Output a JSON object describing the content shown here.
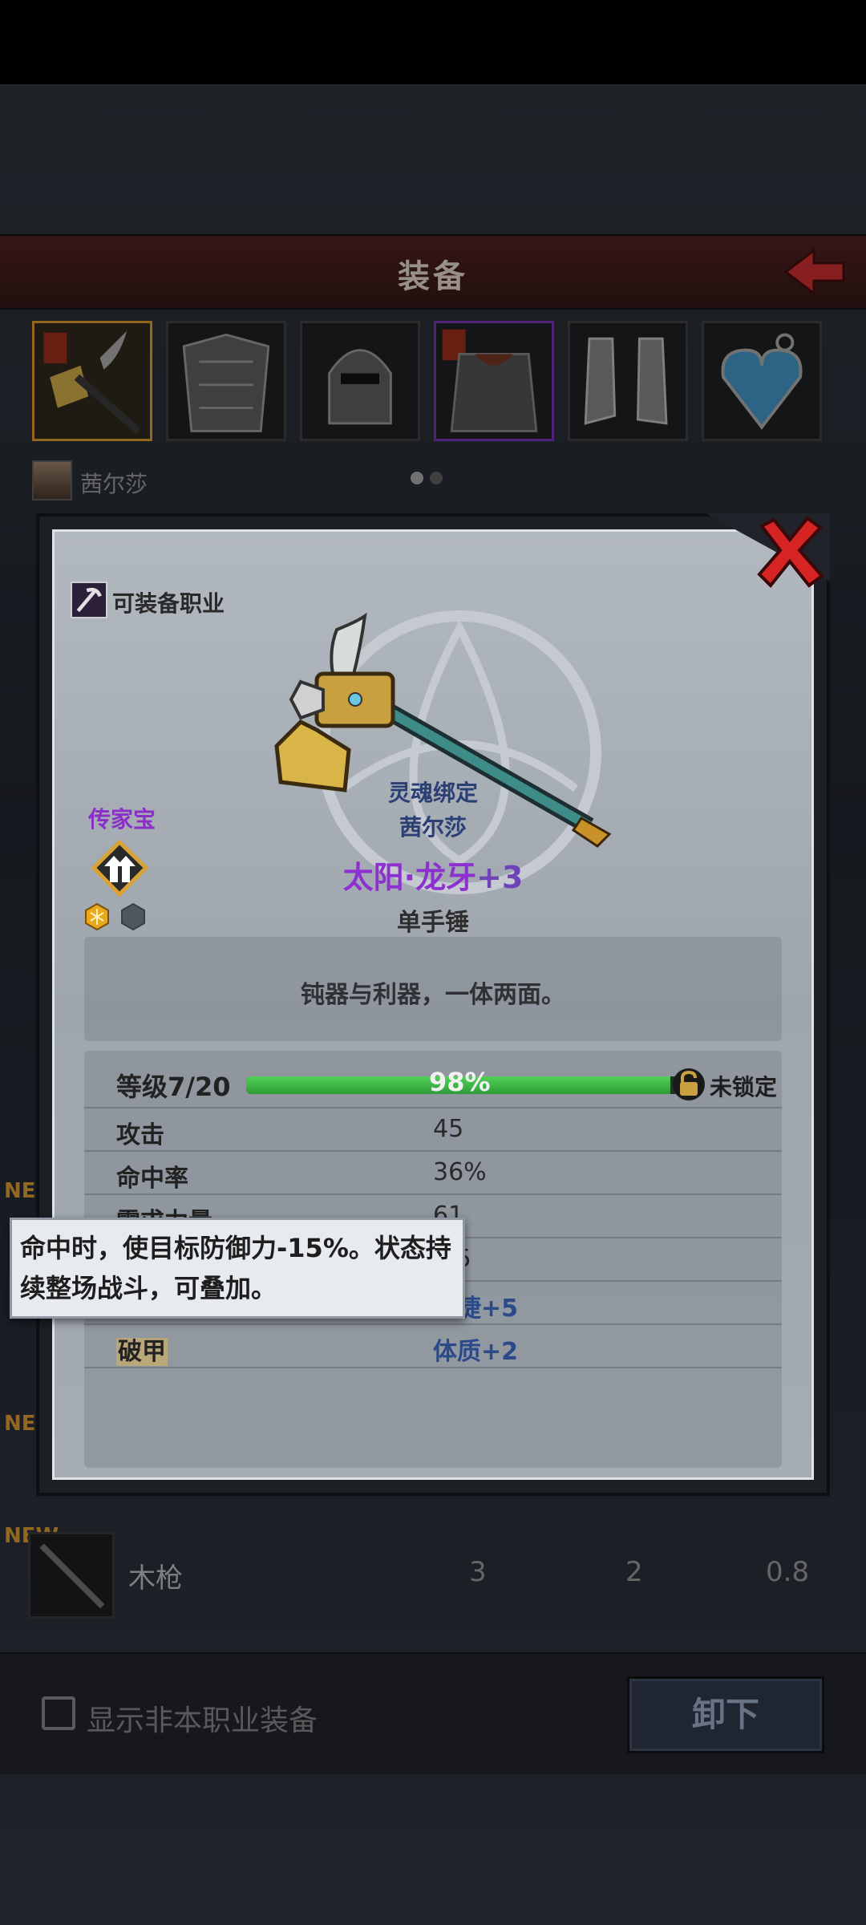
{
  "header": {
    "title": "装备"
  },
  "character": {
    "name": "茜尔莎"
  },
  "list": {
    "new_label": "NEW",
    "row": {
      "name": "木枪",
      "v1": "3",
      "v2": "2",
      "v3": "0.8"
    }
  },
  "bottom": {
    "show_non_class_label": "显示非本职业装备",
    "unequip_label": "卸下"
  },
  "modal": {
    "class_label": "可装备职业",
    "heirloom_label": "传家宝",
    "soulbind_line1": "灵魂绑定",
    "soulbind_line2": "茜尔莎",
    "item_name": "太阳·龙牙",
    "item_plus": "+3",
    "item_type": "单手锤",
    "description": "钝器与利器，一体两面。",
    "level": {
      "label": "等级7/20",
      "progress_text": "98%",
      "progress": 0.98,
      "lock_text": "未锁定"
    },
    "stats": [
      {
        "label": "攻击",
        "value": "45"
      },
      {
        "label": "命中率",
        "value": "36%"
      },
      {
        "label": "需求力量",
        "value": "61"
      },
      {
        "label": "",
        "value": "1.5"
      },
      {
        "label": "",
        "value": "敏捷+5"
      },
      {
        "label": "破甲",
        "value": "体质+2"
      }
    ]
  },
  "tooltip": {
    "text": "命中时，使目标防御力-15%。状态持续整场战斗，可叠加。"
  },
  "colors": {
    "accent_gold": "#c58a2a",
    "legendary_purple": "#8e2fd0",
    "xp_green": "#52d058"
  }
}
